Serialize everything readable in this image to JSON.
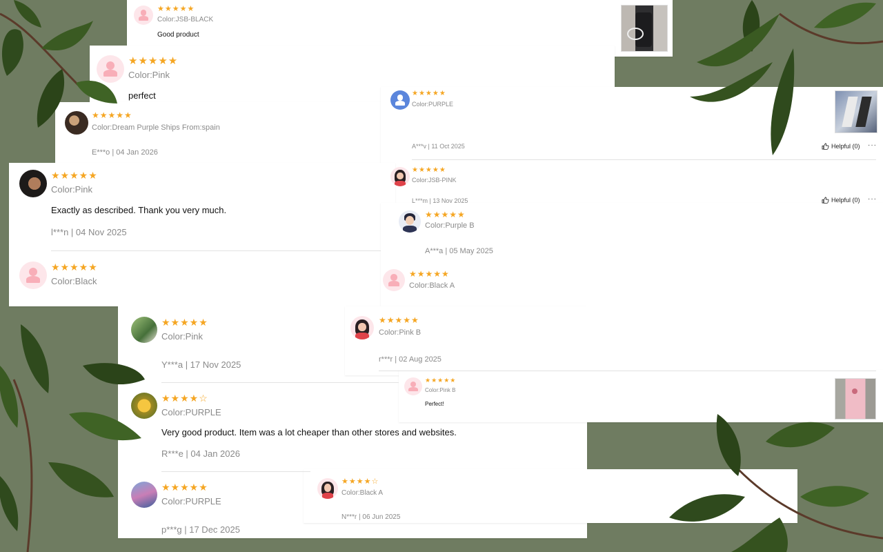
{
  "rating_color": "#f5a623",
  "background_color": "#6f7c61",
  "reviews": [
    {
      "stars": "★★★★★",
      "color": "Color:JSB-BLACK",
      "text": "Good product"
    },
    {
      "stars": "★★★★★",
      "color": "Color:Pink",
      "text": "perfect"
    },
    {
      "stars": "★★★★★",
      "color": "Color:Dream Purple Ships From:spain",
      "author_date": "E***o | 04 Jan 2026"
    },
    {
      "stars": "★★★★★",
      "color": "Color:Pink",
      "text": "Exactly as described. Thank you very much.",
      "author_date": "l***n | 04 Nov 2025"
    },
    {
      "stars": "★★★★★",
      "color": "Color:Black"
    },
    {
      "stars": "★★★★★",
      "color": "Color:PURPLE",
      "author_date": "A***v | 11 Oct 2025",
      "helpful": "Helpful (0)",
      "more": "···"
    },
    {
      "stars": "★★★★★",
      "color": "Color:JSB-PINK",
      "author_date": "L***m | 13 Nov 2025",
      "helpful": "Helpful (0)",
      "more": "···"
    },
    {
      "stars": "★★★★★",
      "color": "Color:Purple B",
      "author_date": "A***a | 05 May 2025"
    },
    {
      "stars": "★★★★★",
      "color": "Color:Black A"
    },
    {
      "stars": "★★★★★",
      "color": "Color:Pink",
      "author_date": "Y***a | 17 Nov 2025"
    },
    {
      "stars": "★★★★★",
      "color": "Color:Pink B",
      "author_date": "r***r | 02 Aug 2025"
    },
    {
      "stars": "★★★★★",
      "color": "Color:Pink B",
      "text": "Perfect!"
    },
    {
      "stars": "★★★★☆",
      "color": "Color:PURPLE",
      "text": "Very good product. Item was a lot cheaper than other stores and websites.",
      "author_date": "R***e | 04 Jan 2026"
    },
    {
      "stars": "★★★★★",
      "color": "Color:PURPLE",
      "author_date": "p***g | 17 Dec 2025"
    },
    {
      "stars": "★★★★☆",
      "color": "Color:Black A",
      "author_date": "N***r | 06 Jun 2025"
    }
  ]
}
